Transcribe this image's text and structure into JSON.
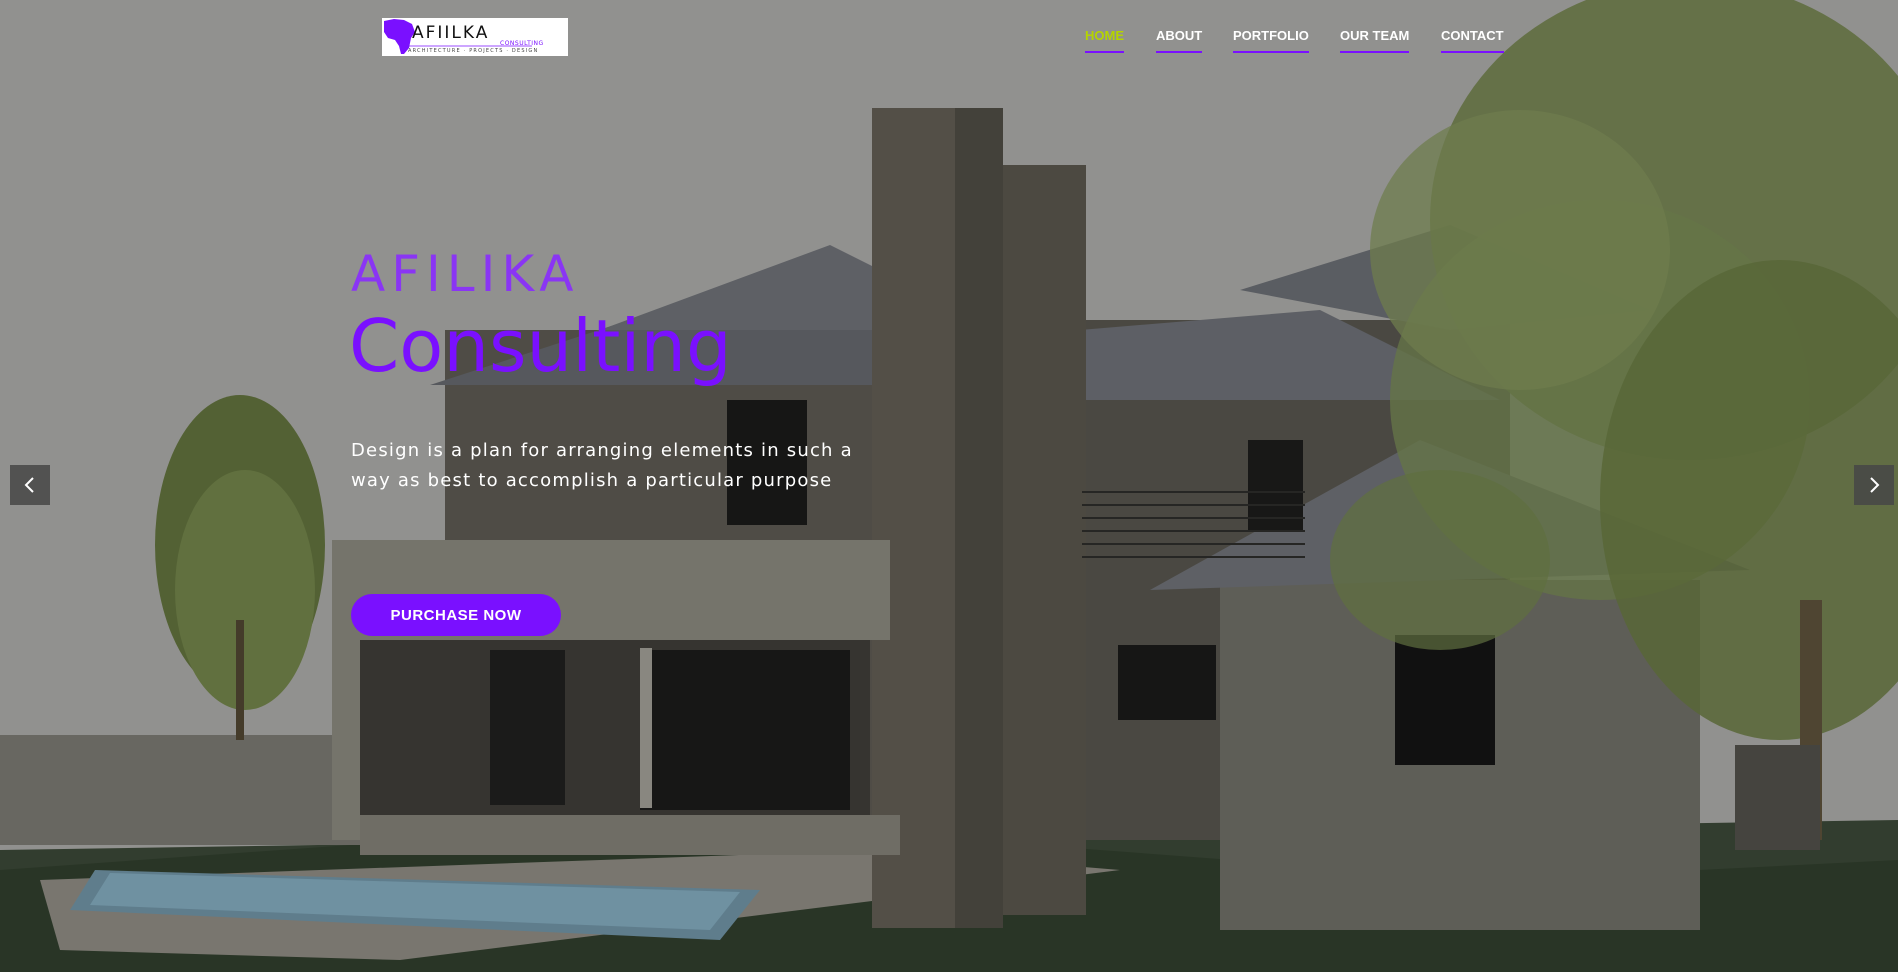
{
  "logo": {
    "wordmark": "AFIILKA",
    "subtitle": "CONSULTING",
    "tagline": "ARCHITECTURE · PROJECTS · DESIGN",
    "icon": "africa-map-icon"
  },
  "nav": {
    "items": [
      {
        "label": "HOME",
        "active": true
      },
      {
        "label": "ABOUT",
        "active": false
      },
      {
        "label": "PORTFOLIO",
        "active": false
      },
      {
        "label": "OUR TEAM",
        "active": false
      },
      {
        "label": "CONTACT",
        "active": false
      }
    ]
  },
  "hero": {
    "brand_small": "AFILIKA",
    "brand_big": "Consulting",
    "tagline": "Design is a plan for arranging elements in such a way as best to accomplish a particular purpose",
    "cta_label": "PURCHASE NOW",
    "prev_icon": "chevron-left-icon",
    "next_icon": "chevron-right-icon"
  },
  "colors": {
    "accent": "#7a10ff",
    "nav_active": "#b4d400",
    "text_light": "#ffffff"
  }
}
